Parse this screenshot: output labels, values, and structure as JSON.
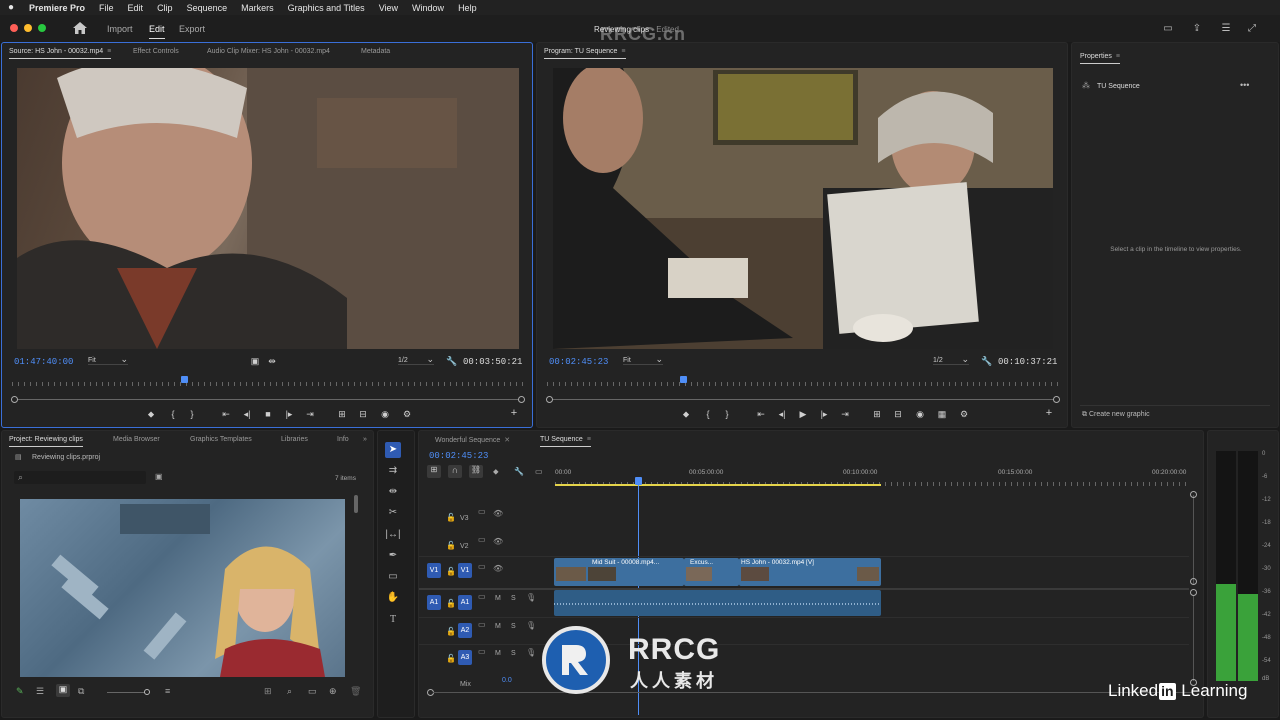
{
  "menubar": {
    "app_name": "Premiere Pro",
    "items": [
      "File",
      "Edit",
      "Clip",
      "Sequence",
      "Markers",
      "Graphics and Titles",
      "View",
      "Window",
      "Help"
    ]
  },
  "header": {
    "workspaces": [
      "Import",
      "Edit",
      "Export"
    ],
    "active_workspace": "Edit",
    "doc_title": "Reviewing clips",
    "doc_status": "- Edited",
    "watermark": "RRCG.cn"
  },
  "source_monitor": {
    "tabs": [
      "Source: HS John - 00032.mp4",
      "Effect Controls",
      "Audio Clip Mixer: HS John - 00032.mp4",
      "Metadata"
    ],
    "timecode_in": "01:47:40:00",
    "fit": "Fit",
    "resolution": "1/2",
    "duration": "00:03:50:21",
    "playhead_fraction": 0.33
  },
  "program_monitor": {
    "tab": "Program: TU Sequence",
    "timecode": "00:02:45:23",
    "fit": "Fit",
    "resolution": "1/2",
    "duration": "00:10:37:21",
    "playhead_fraction": 0.26
  },
  "properties": {
    "title": "Properties",
    "sequence_name": "TU Sequence",
    "empty_message": "Select a clip in the timeline to view properties.",
    "create_graphic": "Create new graphic"
  },
  "project": {
    "tabs": [
      "Project: Reviewing clips",
      "Media Browser",
      "Graphics Templates",
      "Libraries",
      "Info"
    ],
    "file": "Reviewing clips.prproj",
    "items_count": "7 items",
    "search_placeholder": ""
  },
  "timeline": {
    "tabs": [
      "Wonderful Sequence",
      "TU Sequence"
    ],
    "timecode": "00:02:45:23",
    "ruler_labels": [
      "00:00",
      "00:05:00:00",
      "00:10:00:00",
      "00:15:00:00",
      "00:20:00:00"
    ],
    "video_tracks": [
      "V3",
      "V2",
      "V1"
    ],
    "audio_tracks": [
      "A1",
      "A2",
      "A3"
    ],
    "source_patch_video": "V1",
    "source_patch_audio": "A1",
    "mix_label": "Mix",
    "mix_value": "0.0",
    "track_buttons": {
      "mute": "M",
      "solo": "S"
    },
    "clips": [
      {
        "name": "Mid Suit - 00008.mp4..."
      },
      {
        "name": "Excus..."
      },
      {
        "name": "HS John - 00032.mp4 [V]"
      }
    ]
  },
  "audio_meter": {
    "scale": [
      "0",
      "-6",
      "-12",
      "-18",
      "-24",
      "-30",
      "-36",
      "-42",
      "-48",
      "-54",
      "dB"
    ],
    "left_level": 0.42,
    "right_level": 0.38
  },
  "branding": {
    "rrcg_text": "RRCG",
    "rrcg_sub": "人人素材",
    "linkedin_a": "Linked",
    "linkedin_in": "in",
    "linkedin_b": "Learning"
  }
}
